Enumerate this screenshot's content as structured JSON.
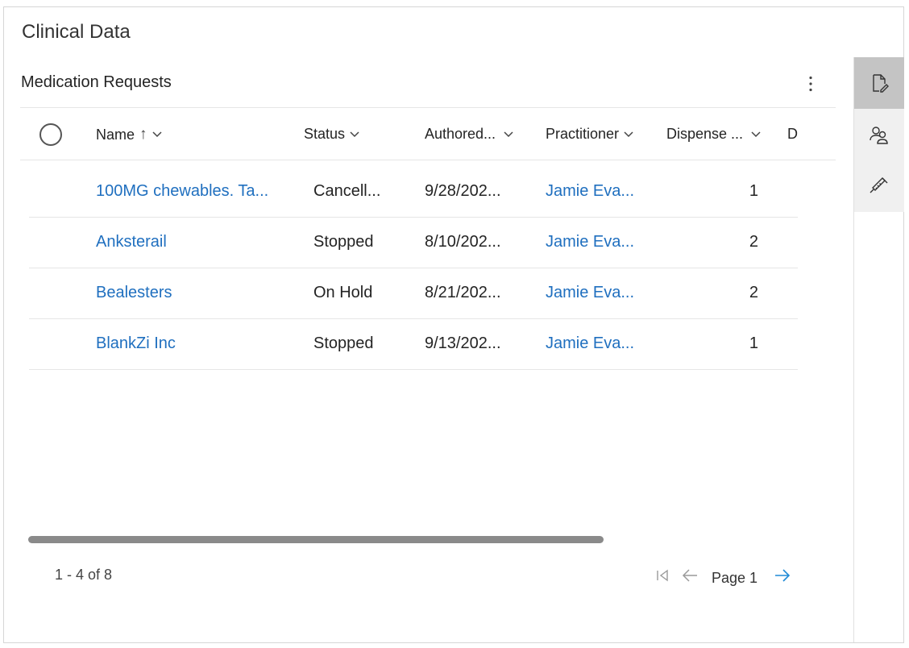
{
  "section": {
    "title": "Clinical Data"
  },
  "subgrid": {
    "title": "Medication Requests"
  },
  "columns": [
    {
      "label": "Name",
      "sort": "↑"
    },
    {
      "label": "Status"
    },
    {
      "label": "Authored..."
    },
    {
      "label": "Practitioner"
    },
    {
      "label": "Dispense ..."
    },
    {
      "label": "D"
    }
  ],
  "rows": [
    {
      "name": "100MG chewables. Ta...",
      "status": "Cancell...",
      "authored": "9/28/202...",
      "practitioner": "Jamie Eva...",
      "dispense": "1"
    },
    {
      "name": "Anksterail",
      "status": "Stopped",
      "authored": "8/10/202...",
      "practitioner": "Jamie Eva...",
      "dispense": "2"
    },
    {
      "name": "Bealesters",
      "status": "On Hold",
      "authored": "8/21/202...",
      "practitioner": "Jamie Eva...",
      "dispense": "2"
    },
    {
      "name": "BlankZi Inc",
      "status": "Stopped",
      "authored": "9/13/202...",
      "practitioner": "Jamie Eva...",
      "dispense": "1"
    }
  ],
  "footer": {
    "count": "1 - 4 of 8",
    "page_label": "Page 1"
  },
  "rail": {
    "items": [
      {
        "icon": "document-edit-icon",
        "active": true
      },
      {
        "icon": "people-icon",
        "active": false
      },
      {
        "icon": "syringe-icon",
        "active": false
      }
    ]
  },
  "colors": {
    "link": "#1f6fbf",
    "rail_active": "#c4c4c4",
    "rail_bg": "#f0f0f0",
    "next_arrow": "#1f8ad6"
  }
}
